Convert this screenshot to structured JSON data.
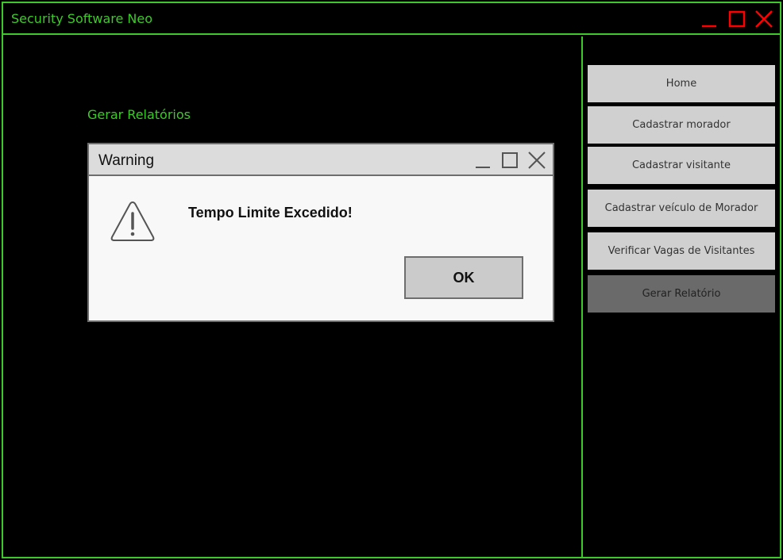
{
  "window": {
    "title": "Security Software Neo",
    "controls": [
      "minimize-icon",
      "maximize-icon",
      "close-icon"
    ],
    "accent_color": "#3ec92a",
    "control_color": "#ff0000"
  },
  "main": {
    "section_title": "Gerar Relatórios"
  },
  "sidebar": {
    "items": [
      {
        "label": "Home",
        "active": false
      },
      {
        "label": "Cadastrar morador",
        "active": false
      },
      {
        "label": "Cadastrar visitante",
        "active": false
      },
      {
        "label": "Cadastrar veículo de Morador",
        "active": false
      },
      {
        "label": "Verificar Vagas de Visitantes",
        "active": false
      },
      {
        "label": "Gerar Relatório",
        "active": true
      }
    ]
  },
  "dialog": {
    "title": "Warning",
    "icon": "warning-icon",
    "message": "Tempo Limite Excedido!",
    "ok_label": "OK"
  }
}
